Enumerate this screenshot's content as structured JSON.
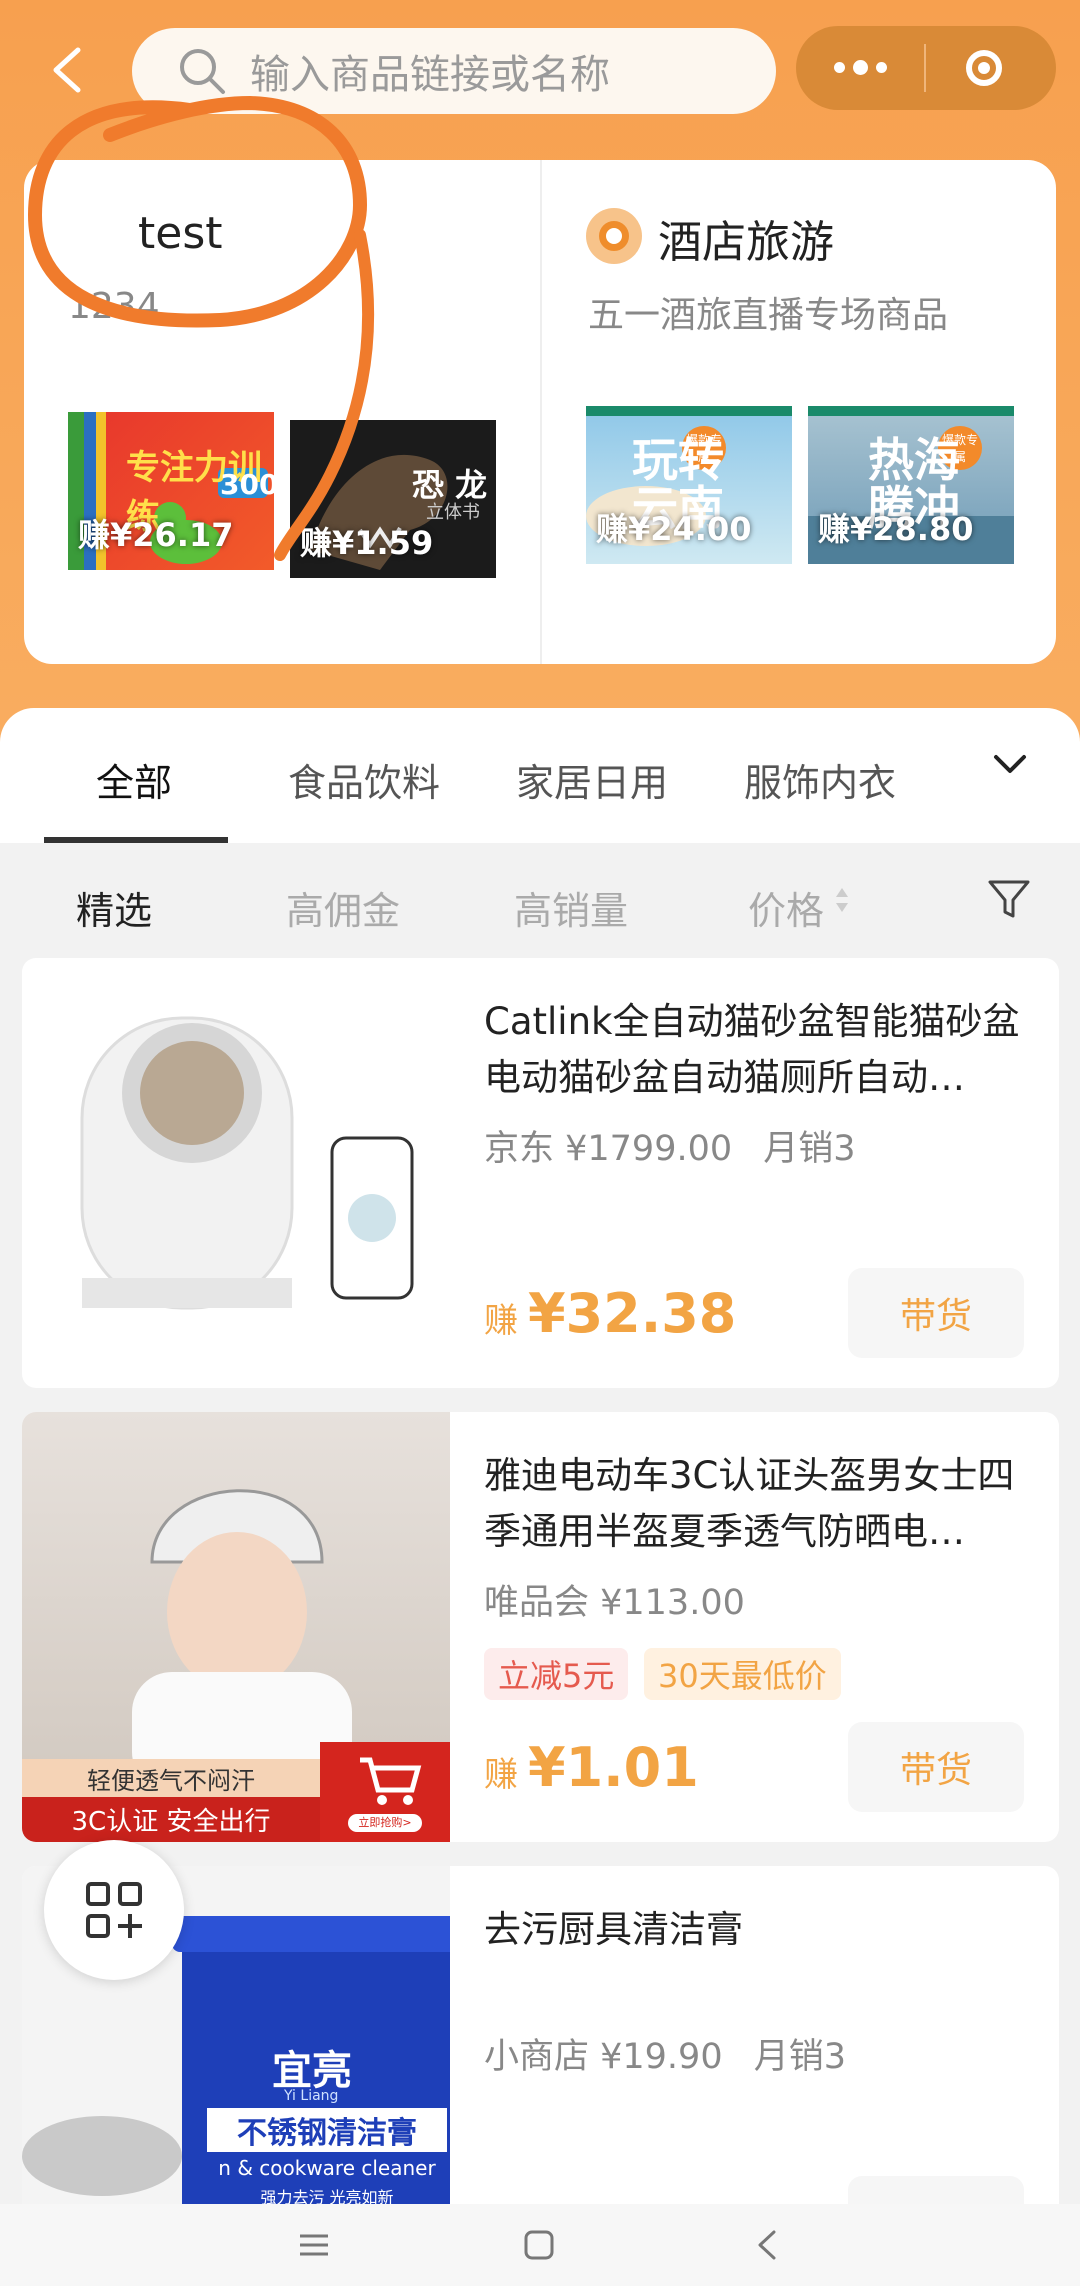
{
  "search": {
    "placeholder": "输入商品链接或名称"
  },
  "colors": {
    "brand_orange": "#f7a04f",
    "earn_orange": "#f2a444",
    "annotation": "#f07b2c"
  },
  "left_card": {
    "title": "test",
    "subtitle": "1234",
    "items": [
      {
        "earn": "赚¥26.17",
        "image_text_1": "专注力训练",
        "image_text_2": "300"
      },
      {
        "earn": "赚¥1.59",
        "image_text_1": "恐 龙",
        "image_text_2": "立体书"
      }
    ]
  },
  "right_card": {
    "title": "酒店旅游",
    "subtitle": "五一酒旅直播专场商品",
    "items": [
      {
        "earn": "赚¥24.00",
        "image_text": "玩转云南",
        "badge": "爆款专属"
      },
      {
        "earn": "赚¥28.80",
        "image_text": "热海腾冲",
        "badge": "爆款专属"
      }
    ]
  },
  "tabs": [
    "全部",
    "食品饮料",
    "家居日用",
    "服饰内衣"
  ],
  "filters": [
    "精选",
    "高佣金",
    "高销量",
    "价格"
  ],
  "products": [
    {
      "name": "Catlink全自动猫砂盆智能猫砂盆电动猫砂盆自动猫厕所自动…",
      "platform_price": "京东 ¥1799.00",
      "sales": "月销3",
      "earn_label": "赚",
      "earn_value": "¥32.38",
      "button": "带货"
    },
    {
      "name": "雅迪电动车3C认证头盔男女士四季通用半盔夏季透气防晒电…",
      "platform_price": "唯品会 ¥113.00",
      "tags": [
        "立减5元",
        "30天最低价"
      ],
      "earn_label": "赚",
      "earn_value": "¥1.01",
      "button": "带货",
      "image_banner_1": "轻便透气不闷汗",
      "image_banner_2": "3C认证 安全出行",
      "image_banner_3": "立即抢购>"
    },
    {
      "name": "去污厨具清洁膏",
      "platform_price": "小商店 ¥19.90",
      "sales": "月销3",
      "image_brand": "宜亮",
      "image_brand_en": "Yi Liang",
      "image_text": "不锈钢清洁膏",
      "image_text_en": "n & cookware cleaner",
      "image_text_small": "强力去污  光亮如新"
    }
  ]
}
